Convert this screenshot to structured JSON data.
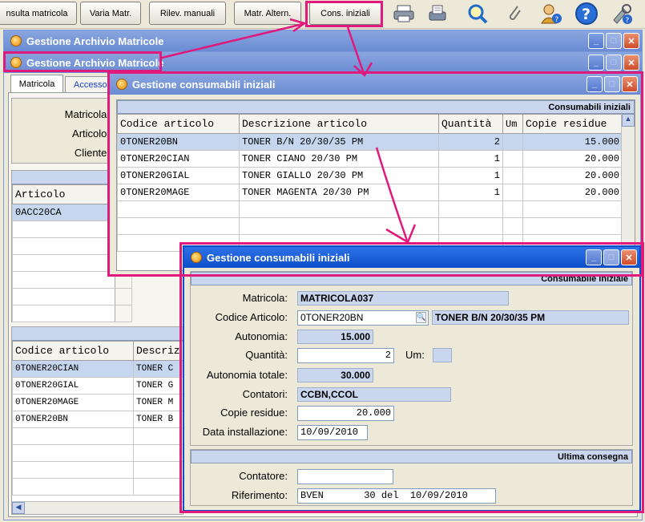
{
  "toolbar": {
    "buttons": [
      "nsulta matricola",
      "Varia Matr.",
      "Rilev. manuali",
      "Matr. Altern.",
      "Cons. iniziali"
    ],
    "icons": [
      "printer-icon",
      "print-preview-icon",
      "search-icon",
      "attachment-icon",
      "user-help-icon",
      "help-icon",
      "tools-icon"
    ]
  },
  "bg_windows": {
    "title1": "Gestione Archivio Matricole",
    "title2": "Gestione Archivio Matricole",
    "tabs": [
      "Matricola",
      "Accesso"
    ],
    "labels": {
      "matricola": "Matricola:",
      "articolo": "Articolo:",
      "cliente": "Cliente:"
    },
    "grid1_header": "Articolo",
    "grid1_rows": [
      "0ACC20CA"
    ],
    "grid2_headers": [
      "Codice articolo",
      "Descriz"
    ],
    "grid2_rows": [
      [
        "0TONER20CIAN",
        "TONER C"
      ],
      [
        "0TONER20GIAL",
        "TONER G"
      ],
      [
        "0TONER20MAGE",
        "TONER M"
      ],
      [
        "0TONER20BN",
        "TONER B"
      ]
    ]
  },
  "list_window": {
    "title": "Gestione consumabili iniziali",
    "panel_title": "Consumabili iniziali",
    "headers": [
      "Codice articolo",
      "Descrizione articolo",
      "Quantità",
      "Um",
      "Copie residue"
    ],
    "rows": [
      [
        "0TONER20BN",
        "TONER B/N 20/30/35 PM",
        "2",
        "",
        "15.000"
      ],
      [
        "0TONER20CIAN",
        "TONER CIANO 20/30 PM",
        "1",
        "",
        "20.000"
      ],
      [
        "0TONER20GIAL",
        "TONER GIALLO 20/30 PM",
        "1",
        "",
        "20.000"
      ],
      [
        "0TONER20MAGE",
        "TONER MAGENTA 20/30 PM",
        "1",
        "",
        "20.000"
      ]
    ]
  },
  "detail_window": {
    "title": "Gestione consumabili iniziali",
    "panel_title": "Consumabile iniziale",
    "labels": {
      "matricola": "Matricola:",
      "codice_articolo": "Codice Articolo:",
      "autonomia": "Autonomia:",
      "quantita": "Quantità:",
      "um": "Um:",
      "autonomia_totale": "Autonomia totale:",
      "contatori": "Contatori:",
      "copie_residue": "Copie residue:",
      "data_installazione": "Data installazione:"
    },
    "values": {
      "matricola": "MATRICOLA037",
      "codice_articolo": "0TONER20BN",
      "descrizione_articolo": "TONER B/N 20/30/35 PM",
      "autonomia": "15.000",
      "quantita": "2",
      "um": "",
      "autonomia_totale": "30.000",
      "contatori": "CCBN,CCOL",
      "copie_residue": "20.000",
      "data_installazione": "10/09/2010"
    },
    "section2_title": "Ultima consegna",
    "labels2": {
      "contatore": "Contatore:",
      "riferimento": "Riferimento:"
    },
    "values2": {
      "contatore": "",
      "riferimento": "BVEN       30 del  10/09/2010"
    }
  },
  "colors": {
    "highlight": "#e0197d",
    "title_active": "#0c4fc9",
    "title_inactive": "#7a97da",
    "readonly": "#c9d6ee"
  }
}
